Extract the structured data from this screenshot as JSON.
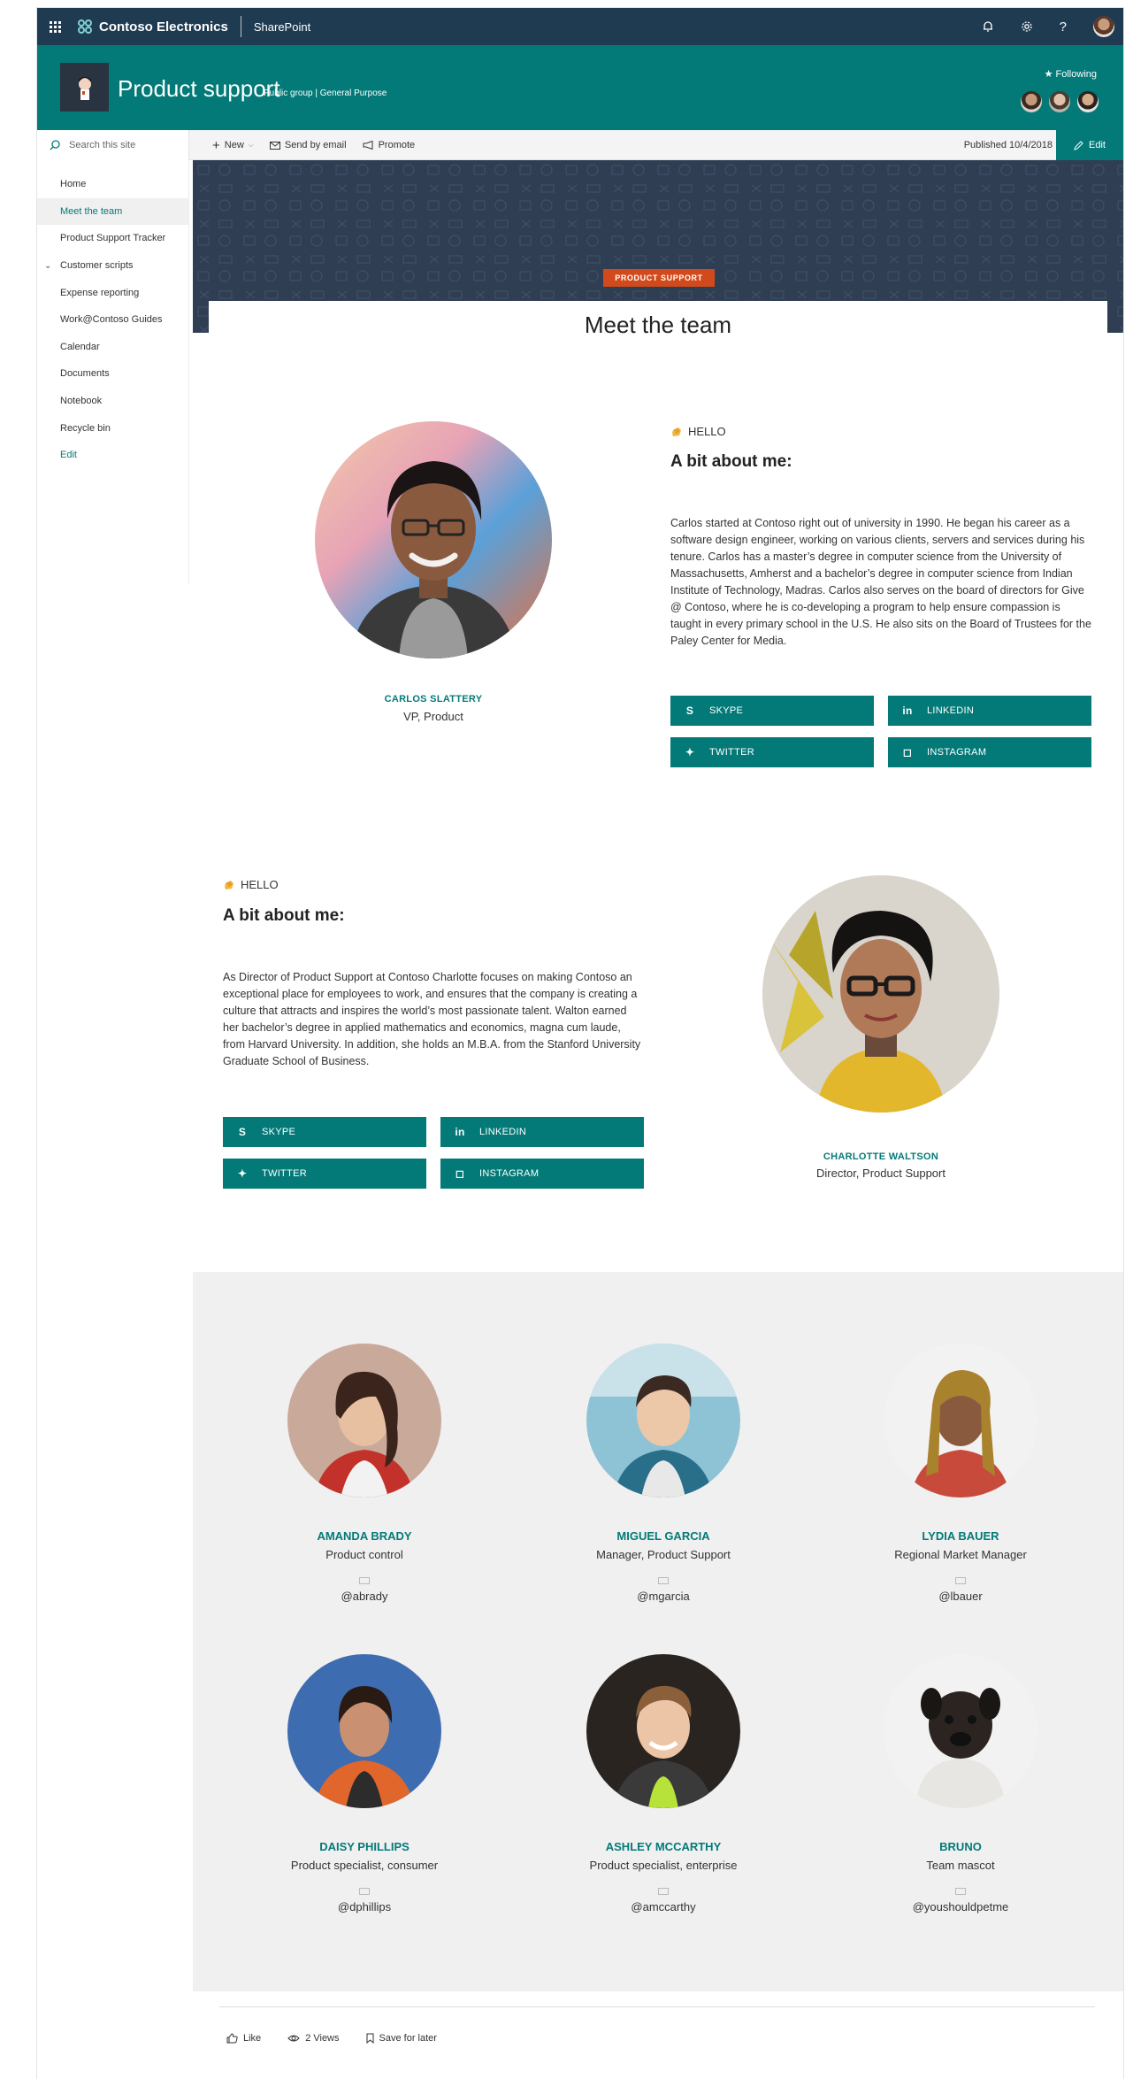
{
  "suite_bar": {
    "company": "Contoso Electronics",
    "app": "SharePoint",
    "icons": [
      "waffle-icon",
      "bell-icon",
      "gear-icon",
      "help-icon",
      "avatar"
    ]
  },
  "site": {
    "title": "Product support",
    "subtitle": "Public group | General Purpose",
    "following": "Following"
  },
  "command_bar": {
    "search_placeholder": "Search this site",
    "new_label": "New",
    "send_label": "Send by email",
    "promote_label": "Promote",
    "published": "Published 10/4/2018",
    "edit_label": "Edit"
  },
  "nav": {
    "items": [
      {
        "label": "Home"
      },
      {
        "label": "Meet the team"
      },
      {
        "label": "Product Support Tracker"
      },
      {
        "label": "Customer scripts"
      },
      {
        "label": "Expense reporting"
      },
      {
        "label": "Work@Contoso Guides"
      },
      {
        "label": "Calendar"
      },
      {
        "label": "Documents"
      },
      {
        "label": "Notebook"
      },
      {
        "label": "Recycle bin"
      },
      {
        "label": "Edit"
      }
    ]
  },
  "banner": {
    "topic": "PRODUCT SUPPORT",
    "title": "Meet the team"
  },
  "bio1": {
    "name": "CARLOS SLATTERY",
    "role": "VP, Product",
    "hello": "HELLO",
    "about_title": "A bit about me:",
    "about_text": "Carlos started at Contoso right out of university in 1990. He began his career as a software design engineer, working on various clients, servers and services during his tenure. Carlos has a master’s degree in computer science from the University of Massachusetts, Amherst and a bachelor’s degree in computer science from Indian Institute of Technology, Madras. Carlos also serves on the board of directors for Give @ Contoso, where he is co-developing a program to help ensure compassion is taught in every primary school in the U.S. He also sits on the Board of Trustees for the Paley Center for Media.",
    "buttons": {
      "skype": "SKYPE",
      "linkedin": "LINKEDIN",
      "twitter": "TWITTER",
      "instagram": "INSTAGRAM"
    }
  },
  "bio2": {
    "name": "CHARLOTTE WALTSON",
    "role": "Director, Product Support",
    "hello": "HELLO",
    "about_title": "A bit about me:",
    "about_text": "As Director of Product Support at Contoso Charlotte focuses on making Contoso an exceptional place for employees to work, and ensures that the company is creating a culture that attracts and inspires the world’s most passionate talent. Walton earned her bachelor’s degree in applied mathematics and economics, magna cum laude, from Harvard University. In addition, she holds an M.B.A. from the Stanford University Graduate School of Business.",
    "buttons": {
      "skype": "SKYPE",
      "linkedin": "LINKEDIN",
      "twitter": "TWITTER",
      "instagram": "INSTAGRAM"
    }
  },
  "team": [
    {
      "name": "AMANDA BRADY",
      "role": "Product control",
      "handle": "@abrady"
    },
    {
      "name": "MIGUEL GARCIA",
      "role": "Manager, Product Support",
      "handle": "@mgarcia"
    },
    {
      "name": "LYDIA BAUER",
      "role": "Regional Market Manager",
      "handle": "@lbauer"
    },
    {
      "name": "DAISY PHILLIPS",
      "role": "Product specialist, consumer",
      "handle": "@dphillips"
    },
    {
      "name": "ASHLEY MCCARTHY",
      "role": "Product specialist, enterprise",
      "handle": "@amccarthy"
    },
    {
      "name": "BRUNO",
      "role": "Team mascot",
      "handle": "@youshouldpetme"
    }
  ],
  "footer": {
    "like": "Like",
    "views": "2 Views",
    "save": "Save for later"
  },
  "colors": {
    "accent": "#037a78",
    "suite_bar": "#1f3b52",
    "banner": "#2f3e52",
    "topic_tag": "#d24a1c",
    "team_bg": "#f0f0f0"
  }
}
